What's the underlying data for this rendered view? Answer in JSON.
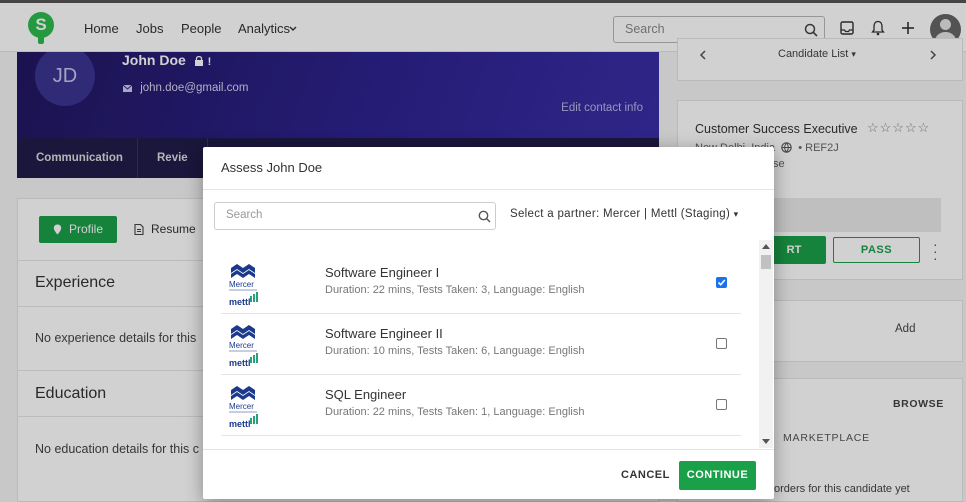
{
  "nav": {
    "links": [
      "Home",
      "Jobs",
      "People",
      "Analytics"
    ],
    "search_placeholder": "Search"
  },
  "candidate": {
    "initials": "JD",
    "name": "John Doe",
    "email": "john.doe@gmail.com",
    "edit_contact": "Edit contact info",
    "tabs": [
      "Communication",
      "Revie"
    ]
  },
  "profile_panel": {
    "profile_btn": "Profile",
    "resume_btn": "Resume",
    "experience_title": "Experience",
    "experience_empty": "No experience details for this",
    "education_title": "Education",
    "education_empty": "No education details for this c"
  },
  "right": {
    "candidate_list": "Candidate List",
    "job_title": "Customer Success Executive",
    "job_location": "New Delhi, India",
    "job_ref": "REF2J",
    "job_extra": "se",
    "start_btn": "RT",
    "pass_btn": "PASS",
    "tests_label": "ts",
    "add_label": "Add",
    "assessments_label": "ts",
    "browse_label": "BROWSE",
    "marketplace_label": "MARKETPLACE",
    "orders_text": "orders for this candidate yet"
  },
  "modal": {
    "title": "Assess John Doe",
    "search_placeholder": "Search",
    "partner_label": "Select a partner: Mercer | Mettl (Staging)",
    "logo_top": "Mercer",
    "logo_bottom": "mettl",
    "tests": [
      {
        "name": "Software Engineer I",
        "meta": "Duration: 22 mins, Tests Taken: 3, Language: English",
        "checked": true
      },
      {
        "name": "Software Engineer II",
        "meta": "Duration: 10 mins, Tests Taken: 6, Language: English",
        "checked": false
      },
      {
        "name": "SQL Engineer",
        "meta": "Duration: 22 mins, Tests Taken: 1, Language: English",
        "checked": false
      }
    ],
    "cancel": "CANCEL",
    "continue": "CONTINUE"
  },
  "colors": {
    "accent": "#1aa049",
    "header_bg": "#2e2390",
    "checkbox": "#1a73e8"
  }
}
